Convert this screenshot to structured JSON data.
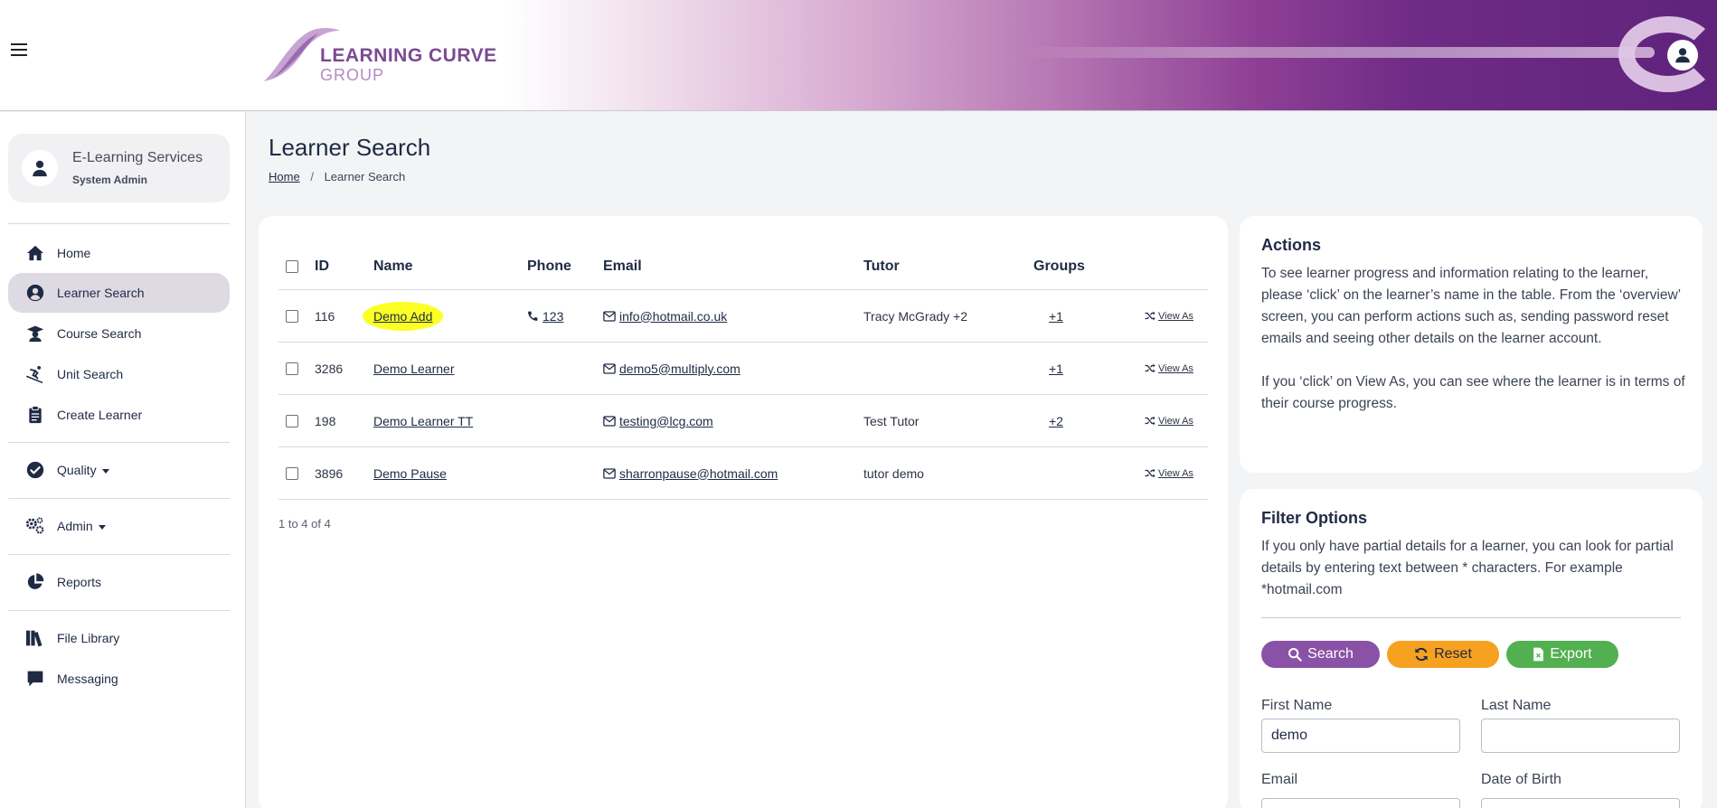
{
  "header": {
    "logo_line1": "LEARNING CURVE",
    "logo_line2": "GROUP"
  },
  "profile": {
    "name": "E-Learning Services",
    "role": "System Admin"
  },
  "sidebar": {
    "items": [
      {
        "label": "Home",
        "icon": "home-icon"
      },
      {
        "label": "Learner Search",
        "icon": "user-circle-icon",
        "active": true
      },
      {
        "label": "Course Search",
        "icon": "graduate-icon"
      },
      {
        "label": "Unit Search",
        "icon": "skiing-icon"
      },
      {
        "label": "Create Learner",
        "icon": "clipboard-icon"
      },
      {
        "label": "Quality",
        "icon": "check-circle-icon",
        "dropdown": true
      },
      {
        "label": "Admin",
        "icon": "cogs-icon",
        "dropdown": true
      },
      {
        "label": "Reports",
        "icon": "pie-chart-icon"
      },
      {
        "label": "File Library",
        "icon": "books-icon"
      },
      {
        "label": "Messaging",
        "icon": "message-icon"
      }
    ]
  },
  "page": {
    "title": "Learner Search",
    "breadcrumb_home": "Home",
    "breadcrumb_sep": "/",
    "breadcrumb_current": "Learner Search"
  },
  "table": {
    "headers": {
      "id": "ID",
      "name": "Name",
      "phone": "Phone",
      "email": "Email",
      "tutor": "Tutor",
      "groups": "Groups"
    },
    "rows": [
      {
        "id": "116",
        "name": "Demo Add",
        "phone": "123",
        "email": "info@hotmail.co.uk",
        "tutor": "Tracy McGrady +2",
        "groups": "+1",
        "view_as": "View As",
        "highlighted": true
      },
      {
        "id": "3286",
        "name": "Demo Learner",
        "phone": "",
        "email": "demo5@multiply.com",
        "tutor": "",
        "groups": "+1",
        "view_as": "View As"
      },
      {
        "id": "198",
        "name": "Demo Learner TT",
        "phone": "",
        "email": "testing@lcg.com",
        "tutor": "Test Tutor",
        "groups": "+2",
        "view_as": "View As"
      },
      {
        "id": "3896",
        "name": "Demo Pause",
        "phone": "",
        "email": "sharronpause@hotmail.com",
        "tutor": "tutor demo",
        "groups": "",
        "view_as": "View As"
      }
    ],
    "footer": "1 to 4 of 4"
  },
  "actions": {
    "title": "Actions",
    "text1": "To see learner progress and information relating to the learner, please ‘click’ on the learner’s name in the table. From the ‘overview’ screen, you can perform actions such as, sending password reset emails and seeing other details on the learner account.",
    "text2": "If you ‘click’ on View As, you can see where the learner is in terms of their course progress."
  },
  "filter": {
    "title": "Filter Options",
    "text": "If you only have partial details for a learner, you can look for partial details by entering text between * characters. For example *hotmail.com",
    "search_label": "Search",
    "reset_label": "Reset",
    "export_label": "Export",
    "first_name_label": "First Name",
    "first_name_value": "demo",
    "last_name_label": "Last Name",
    "last_name_value": "",
    "email_label": "Email",
    "dob_label": "Date of Birth"
  },
  "colors": {
    "brand_purple": "#8a52a6",
    "reset_orange": "#f7a120",
    "export_green": "#53b050",
    "highlight_yellow": "#fbff25"
  }
}
